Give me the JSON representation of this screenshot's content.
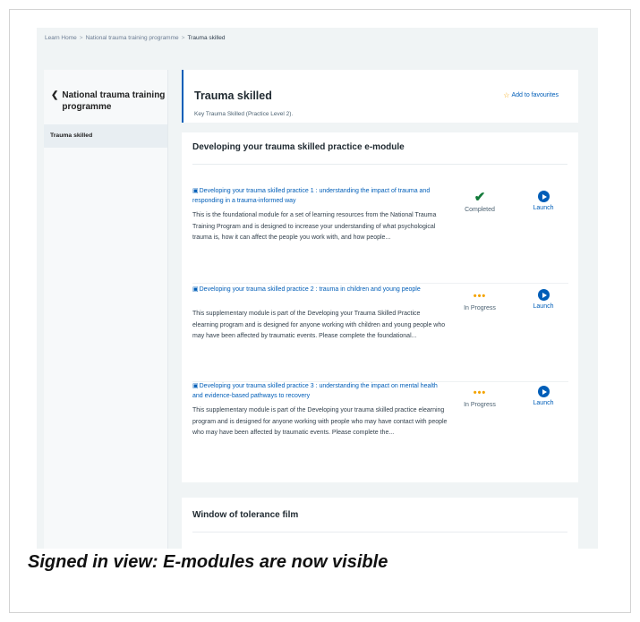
{
  "breadcrumb": {
    "items": [
      "Learn Home",
      "National trauma training programme",
      "Trauma skilled"
    ],
    "separator": ">"
  },
  "sidebar": {
    "back_label": "National trauma training programme",
    "back_icon": "chevron-left-icon",
    "items": [
      {
        "label": "Trauma skilled",
        "active": true
      }
    ]
  },
  "header": {
    "title": "Trauma skilled",
    "subtitle": "Key Trauma Skilled (Practice Level 2).",
    "favourite_label": "Add to favourites",
    "favourite_icon": "star-icon"
  },
  "section": {
    "title": "Developing your trauma skilled practice e-module",
    "modules": [
      {
        "title": "Developing your trauma skilled practice 1 : understanding the impact of trauma and responding in a trauma-informed way",
        "description": "This is the foundational module for a set of learning resources from the National Trauma Training Program and is designed to increase your understanding of what psychological trauma is, how it can affect the people you work with, and how people...",
        "status": "Completed",
        "status_icon": "check-icon",
        "launch_label": "Launch"
      },
      {
        "title": "Developing your trauma skilled practice 2 : trauma in children and young people",
        "description": "This supplementary module is part of the Developing your Trauma Skilled Practice elearning program and is designed for anyone working with children and young people who may have been affected by traumatic events. Please complete the foundational...",
        "status": "In Progress",
        "status_icon": "in-progress-dots-icon",
        "launch_label": "Launch"
      },
      {
        "title": "Developing your trauma skilled practice 3 : understanding the impact on mental health and evidence-based pathways to recovery",
        "description": "This supplementary module is part of the Developing your trauma skilled practice elearning program and is designed for anyone working with people who may have contact with people who may have been affected by traumatic events. Please complete the...",
        "status": "In Progress",
        "status_icon": "in-progress-dots-icon",
        "launch_label": "Launch"
      }
    ]
  },
  "section2": {
    "title": "Window of tolerance film"
  },
  "caption": "Signed in view: E-modules are now visible",
  "colors": {
    "brand_blue": "#005eb8",
    "completed_green": "#127a39",
    "in_progress_amber": "#f4a300",
    "page_background": "#f0f4f5"
  }
}
